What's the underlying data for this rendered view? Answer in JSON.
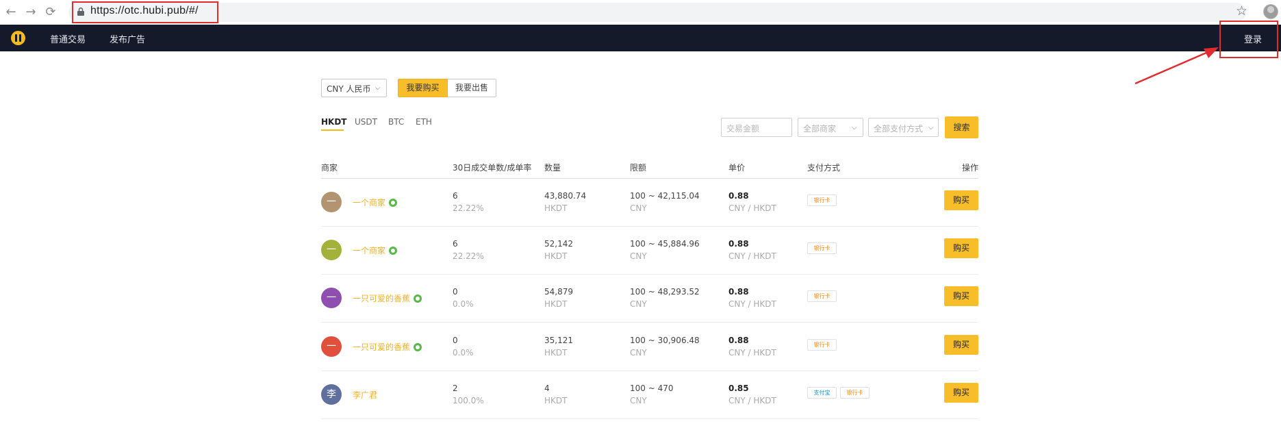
{
  "browser": {
    "url": "https://otc.hubi.pub/#/",
    "back_icon": "arrow-left-icon",
    "forward_icon": "arrow-right-icon",
    "reload_icon": "reload-icon"
  },
  "nav": {
    "links": [
      "普通交易",
      "发布广告"
    ],
    "login_label": "登录"
  },
  "controls": {
    "currency": "CNY 人民币",
    "buy_tab": "我要购买",
    "sell_tab": "我要出售",
    "coins": [
      "HKDT",
      "USDT",
      "BTC",
      "ETH"
    ],
    "active_coin": "HKDT",
    "amount_placeholder": "交易金额",
    "merchant_filter": "全部商家",
    "payment_filter": "全部支付方式",
    "search_label": "搜索"
  },
  "table": {
    "headers": [
      "商家",
      "30日成交单数/成单率",
      "数量",
      "限额",
      "单价",
      "支付方式",
      "操作"
    ],
    "buy_label": "购买",
    "rows": [
      {
        "avatar": "一",
        "avatar_color": "#b39470",
        "merchant": "一个商家",
        "verified": true,
        "orders": "6",
        "rate": "22.22%",
        "amount": "43,880.74",
        "amount_unit": "HKDT",
        "limit": "100 ~ 42,115.04",
        "limit_unit": "CNY",
        "price": "0.88",
        "price_unit": "CNY / HKDT",
        "payments": [
          "银行卡"
        ]
      },
      {
        "avatar": "一",
        "avatar_color": "#a2b23a",
        "merchant": "一个商家",
        "verified": true,
        "orders": "6",
        "rate": "22.22%",
        "amount": "52,142",
        "amount_unit": "HKDT",
        "limit": "100 ~ 45,884.96",
        "limit_unit": "CNY",
        "price": "0.88",
        "price_unit": "CNY / HKDT",
        "payments": [
          "银行卡"
        ]
      },
      {
        "avatar": "一",
        "avatar_color": "#8e4fb0",
        "merchant": "一只可爱的香蕉",
        "verified": true,
        "orders": "0",
        "rate": "0.0%",
        "amount": "54,879",
        "amount_unit": "HKDT",
        "limit": "100 ~ 48,293.52",
        "limit_unit": "CNY",
        "price": "0.88",
        "price_unit": "CNY / HKDT",
        "payments": [
          "银行卡"
        ]
      },
      {
        "avatar": "一",
        "avatar_color": "#e0503c",
        "merchant": "一只可爱的香蕉",
        "verified": true,
        "orders": "0",
        "rate": "0.0%",
        "amount": "35,121",
        "amount_unit": "HKDT",
        "limit": "100 ~ 30,906.48",
        "limit_unit": "CNY",
        "price": "0.88",
        "price_unit": "CNY / HKDT",
        "payments": [
          "银行卡"
        ]
      },
      {
        "avatar": "李",
        "avatar_color": "#5f6f9e",
        "merchant": "李广君",
        "verified": false,
        "orders": "2",
        "rate": "100.0%",
        "amount": "4",
        "amount_unit": "HKDT",
        "limit": "100 ~ 470",
        "limit_unit": "CNY",
        "price": "0.85",
        "price_unit": "CNY / HKDT",
        "payments": [
          "支付宝",
          "银行卡"
        ]
      }
    ]
  }
}
